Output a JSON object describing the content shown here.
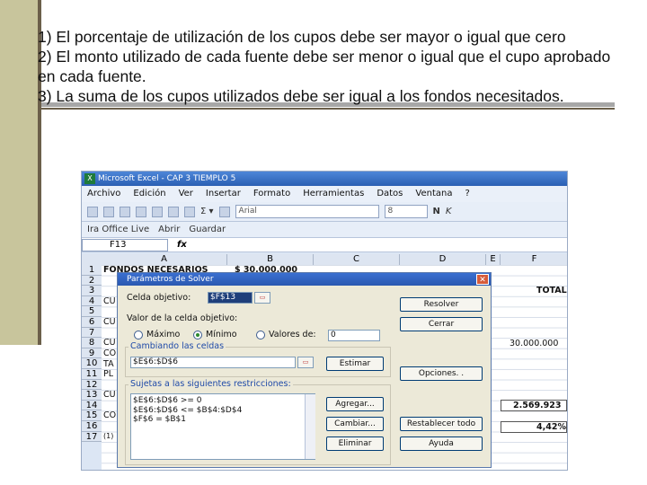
{
  "slide": {
    "lines": [
      "1) El porcentaje de utilización de los cupos debe ser mayor o igual que cero",
      "2) El monto utilizado de cada fuente debe ser menor o igual que el cupo aprobado en cada fuente.",
      "3) La suma de los cupos utilizados debe ser igual a los fondos necesitados."
    ]
  },
  "excel": {
    "title": "Microsoft Excel - CAP 3 TIEMPLO 5",
    "menu": [
      "Archivo",
      "Edición",
      "Ver",
      "Insertar",
      "Formato",
      "Herramientas",
      "Datos",
      "Ventana",
      "?"
    ],
    "font_name": "Arial",
    "font_size": "8",
    "toolbar2": [
      "Ira Office Live",
      "Abrir",
      "Guardar"
    ],
    "name_box": "F13",
    "fx": "fx",
    "columns": [
      "A",
      "B",
      "C",
      "D",
      "E",
      "F"
    ],
    "rows": [
      "1",
      "2",
      "3",
      "4",
      "5",
      "6",
      "7",
      "8",
      "9",
      "10",
      "11",
      "12",
      "13",
      "14",
      "15",
      "16",
      "17"
    ],
    "cells": {
      "a1": "FONDOS NECESARIOS",
      "b1": "$ 30.000.000",
      "f3": "TOTAL",
      "a4": "CU",
      "a6": "CU",
      "a8": "CU",
      "f8": "30.000.000",
      "a9": "CO",
      "a10": "TA",
      "a11": "PL",
      "a13": "CU",
      "f13": "2.569.923",
      "a15": "CO",
      "f15": "4,42%",
      "a16": "(1)"
    }
  },
  "dialog": {
    "title": "Parámetros de Solver",
    "target_label": "Celda objetivo:",
    "target_value": "$F$13",
    "value_label": "Valor de la celda objetivo:",
    "opt_max": "Máximo",
    "opt_min": "Mínimo",
    "opt_values": "Valores de:",
    "values_input": "0",
    "changing_label": "Cambiando las celdas",
    "changing_value": "$E$6:$D$6",
    "constraints_label": "Sujetas a las siguientes restricciones:",
    "constraints": [
      "$E$6:$D$6 >= 0",
      "$E$6:$D$6 <= $B$4:$D$4",
      "$F$6 = $B$1"
    ],
    "btn_solve": "Resolver",
    "btn_close": "Cerrar",
    "btn_guess": "Estimar",
    "btn_options": "Opciones. .",
    "btn_add": "Agregar...",
    "btn_change": "Cambiar...",
    "btn_reset": "Restablecer todo",
    "btn_delete": "Eliminar",
    "btn_help": "Ayuda"
  }
}
